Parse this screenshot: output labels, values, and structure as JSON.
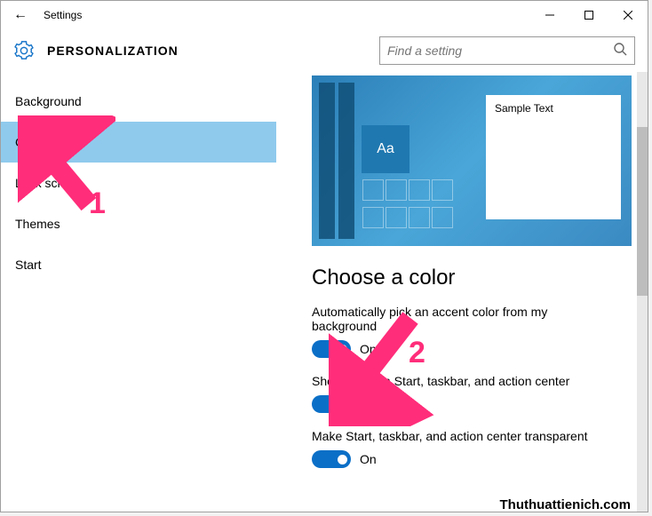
{
  "window": {
    "title": "Settings"
  },
  "header": {
    "page_title": "PERSONALIZATION"
  },
  "search": {
    "placeholder": "Find a setting"
  },
  "sidebar": {
    "items": [
      {
        "label": "Background",
        "selected": false
      },
      {
        "label": "Colors",
        "selected": true
      },
      {
        "label": "Lock screen",
        "selected": false
      },
      {
        "label": "Themes",
        "selected": false
      },
      {
        "label": "Start",
        "selected": false
      }
    ]
  },
  "preview": {
    "sample_text": "Sample Text",
    "tile_label": "Aa"
  },
  "content": {
    "section_title": "Choose a color",
    "settings": [
      {
        "label": "Automatically pick an accent color from my background",
        "state": "On"
      },
      {
        "label": "Show color on Start, taskbar, and action center",
        "state": "On"
      },
      {
        "label": "Make Start, taskbar, and action center transparent",
        "state": "On"
      }
    ]
  },
  "annotations": {
    "a1": "1",
    "a2": "2"
  },
  "watermark": "Thuthuattienich.com",
  "colors": {
    "accent": "#0b6fc7",
    "selected_bg": "#8fcaed",
    "arrow": "#ff2d7a"
  }
}
